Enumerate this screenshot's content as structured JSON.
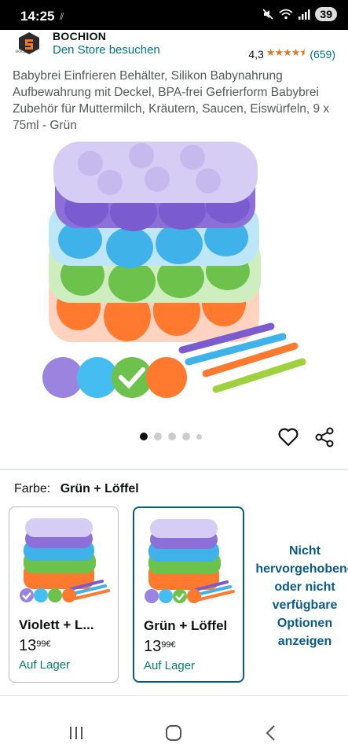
{
  "status_bar": {
    "time": "14:25",
    "notif_glyph": "⫽",
    "battery": "39"
  },
  "store": {
    "brand": "BOCHION",
    "logo_text": "BOCHION",
    "link": "Den Store besuchen",
    "rating_value": "4,3",
    "rating_stars": "★★★★⯨",
    "rating_count": "(659)"
  },
  "product": {
    "title": "Babybrei Einfrieren Behälter, Silikon Babynahrung Aufbewahrung mit Deckel, BPA-frei Gefrierform Babybrei Zubehör für Muttermilch, Kräutern, Saucen, Eiswürfeln, 9 x 75ml - Grün"
  },
  "carousel": {
    "count": 5,
    "active_index": 0
  },
  "color_selector": {
    "label": "Farbe:",
    "value": "Grün + Löffel"
  },
  "variants": [
    {
      "name": "Violett + L...",
      "price_whole": "13",
      "price_fraction": "99",
      "currency": "€",
      "stock": "Auf Lager",
      "selected": false
    },
    {
      "name": "Grün + Löffel",
      "price_whole": "13",
      "price_fraction": "99",
      "currency": "€",
      "stock": "Auf Lager",
      "selected": true
    }
  ],
  "unavailable_note": "Nicht hervorgehobene oder nicht verfügbare Optionen anzeigen",
  "colors": {
    "link": "#007185",
    "star": "#de7921",
    "stock_green": "#067d62",
    "selected_border": "#0a5b8c",
    "lid": "#c9bff0",
    "tray_purple": "#8c6fd8",
    "tray_blue": "#3fb2ea",
    "tray_green": "#6cc24a",
    "tray_orange": "#ff7a2f"
  },
  "icons": {
    "status": [
      "mute-icon",
      "wifi-icon",
      "signal-icon"
    ],
    "actions": [
      "heart-icon",
      "share-icon"
    ],
    "nav": [
      "recent-apps-icon",
      "home-icon",
      "back-icon"
    ]
  }
}
